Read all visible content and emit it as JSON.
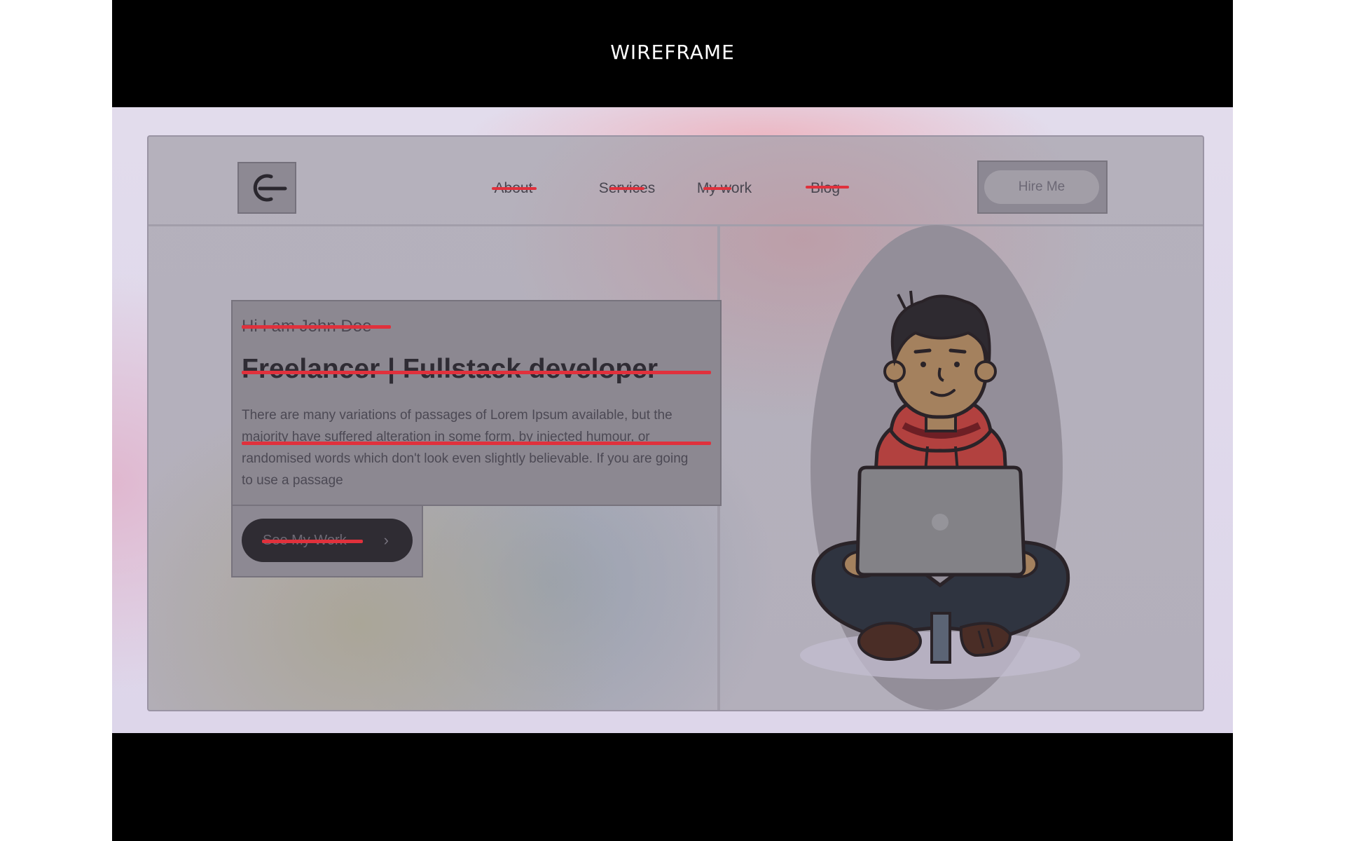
{
  "frame_title": "WIREFRAME",
  "nav": {
    "items": [
      {
        "label": "About"
      },
      {
        "label": "Services"
      },
      {
        "label": "My work"
      },
      {
        "label": "Blog"
      }
    ],
    "hire_label": "Hire Me"
  },
  "hero": {
    "greeting": "Hi I am John Doe",
    "headline": "Freelancer | Fullstack developer",
    "paragraph": "There are many variations of passages of Lorem Ipsum available, but the majority have suffered alteration in some form, by injected humour, or randomised words which don't look even slightly believable. If you are going to use a passage",
    "cta_label": "See My Work",
    "cta_icon": "chevron-right-icon"
  },
  "icons": {
    "logo": "power-logo-icon",
    "illustration": "developer-with-laptop-illustration"
  },
  "colors": {
    "strike": "#e0313c",
    "frame": "#000000"
  }
}
